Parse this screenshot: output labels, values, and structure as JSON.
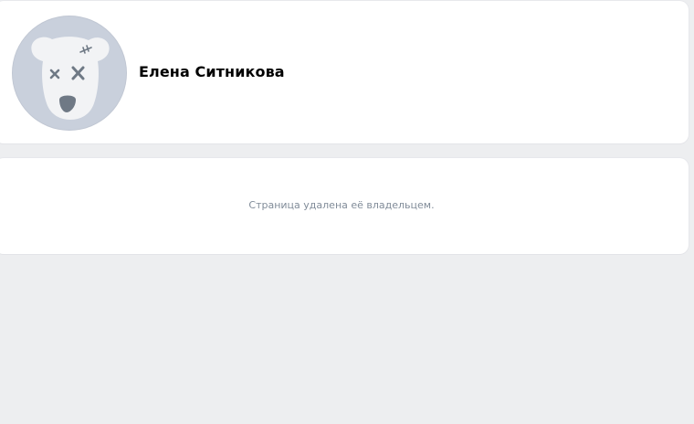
{
  "profile": {
    "name": "Елена Ситникова",
    "avatar_icon": "deleted-dog-avatar-icon"
  },
  "status": {
    "message": "Страница удалена её владельцем."
  },
  "colors": {
    "page_background": "#edeef0",
    "card_background": "#ffffff",
    "avatar_background": "#c9d0dc",
    "message_text": "#818c99"
  }
}
